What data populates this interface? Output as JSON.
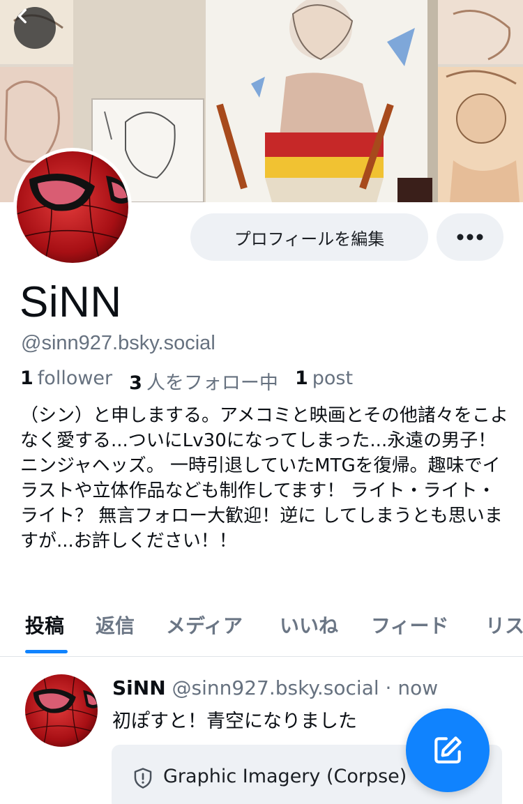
{
  "profile": {
    "display_name": "SiNN",
    "handle": "@sinn927.bsky.social",
    "followers_count": "1",
    "followers_label": "follower",
    "following_count": "3",
    "following_label": "人をフォロー中",
    "posts_count": "1",
    "posts_label": "post",
    "bio": "（シン）と申しまする。アメコミと映画とその他諸々をこよなく愛する...ついにLv30になってしまった...永遠の男子！ニンジャヘッズ。 一時引退していたMTGを復帰。趣味でイラストや立体作品なども制作してます！ ライト・ライト・ライト？ 無言フォロー大歓迎！逆に してしまうとも思いますが...お許しください！！"
  },
  "header": {
    "edit_profile_label": "プロフィールを編集",
    "back_icon": "chevron-left-icon",
    "more_icon": "ellipsis-icon"
  },
  "tabs": [
    {
      "label": "投稿",
      "active": true
    },
    {
      "label": "返信",
      "active": false
    },
    {
      "label": "メディア",
      "active": false
    },
    {
      "label": "いいね",
      "active": false
    },
    {
      "label": "フィード",
      "active": false
    },
    {
      "label": "リスト",
      "active": false
    }
  ],
  "post": {
    "author": "SiNN",
    "handle": "@sinn927.bsky.social",
    "separator": "·",
    "time": "now",
    "text": "初ぽすと！青空になりました",
    "content_warning": "Graphic Imagery (Corpse)",
    "warning_icon": "shield-alert-icon"
  },
  "fab": {
    "icon": "compose-icon"
  },
  "colors": {
    "accent": "#1083fe",
    "muted_text": "#66717f",
    "button_bg": "#eef1f5"
  }
}
